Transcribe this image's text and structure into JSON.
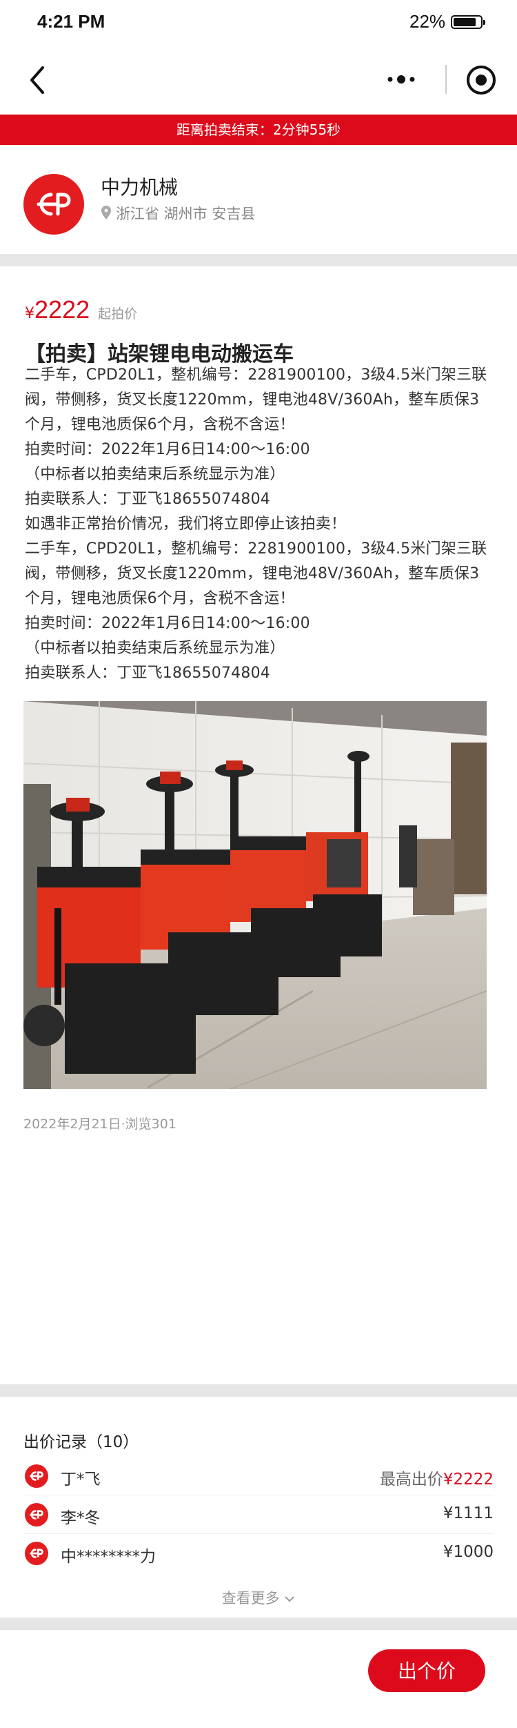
{
  "status_bar": {
    "time": "4:21 PM",
    "battery": "22%"
  },
  "countdown": "距离拍卖结束：2分钟55秒",
  "store": {
    "name": "中力机械",
    "location": "浙江省 湖州市 安吉县"
  },
  "listing": {
    "price_symbol": "¥",
    "price": "2222",
    "price_label": "起拍价",
    "title": "【拍卖】站架锂电电动搬运车",
    "description": "二手车，CPD20L1，整机编号：2281900100，3级4.5米门架三联阀，带侧移，货叉长度1220mm，锂电池48V/360Ah，整车质保3个月，锂电池质保6个月，含税不含运！\n拍卖时间：2022年1月6日14:00～16:00\n（中标者以拍卖结束后系统显示为准）\n拍卖联系人：丁亚飞18655074804\n如遇非正常抬价情况，我们将立即停止该拍卖！\n二手车，CPD20L1，整机编号：2281900100，3级4.5米门架三联阀，带侧移，货叉长度1220mm，锂电池48V/360Ah，整车质保3个月，锂电池质保6个月，含税不含运！\n拍卖时间：2022年1月6日14:00～16:00\n（中标者以拍卖结束后系统显示为准）\n拍卖联系人：丁亚飞18655074804",
    "post_meta": "2022年2月21日·浏览301"
  },
  "bids": {
    "title": "出价记录（10）",
    "items": [
      {
        "name": "丁*飞",
        "label": "最高出价",
        "price": "¥2222"
      },
      {
        "name": "李*冬",
        "label": "",
        "price": "¥1111"
      },
      {
        "name": "中********力",
        "label": "",
        "price": "¥1000"
      }
    ],
    "see_more": "查看更多"
  },
  "bottom": {
    "bid_button": "出个价"
  },
  "colors": {
    "accent": "#dc0a1a",
    "logo": "#e31d1f"
  },
  "icons": [
    "back-icon",
    "more-icon",
    "target-icon",
    "pin-icon",
    "chevron-down-icon"
  ]
}
